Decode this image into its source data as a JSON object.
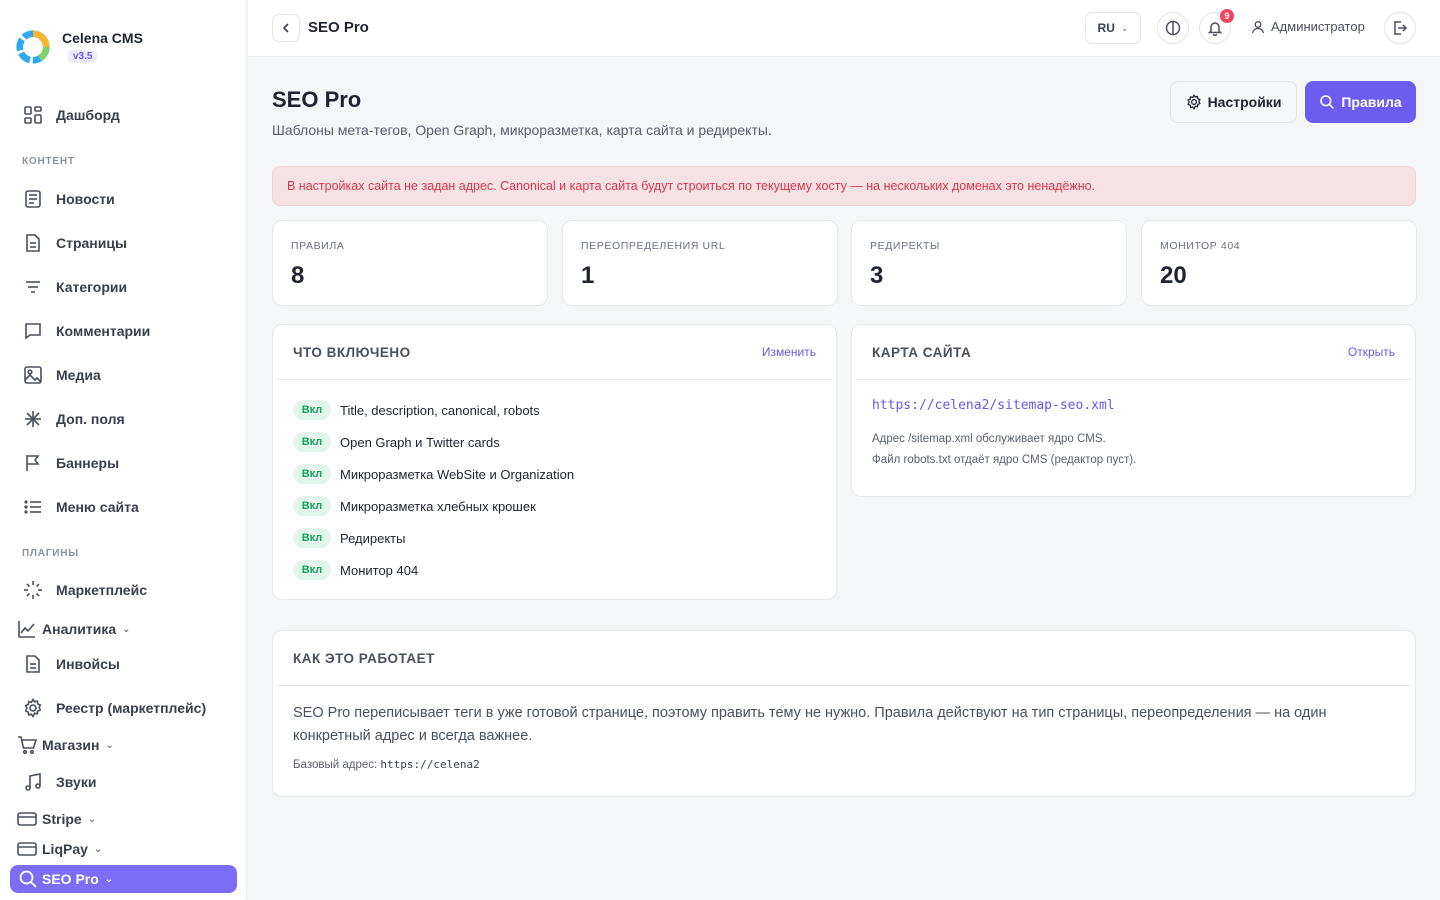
{
  "brand": {
    "name": "Celena CMS",
    "version": "v3.5"
  },
  "sidebar": {
    "items": [
      {
        "label": "Дашборд",
        "icon": "dashboard-icon"
      },
      {
        "label": "Новости",
        "icon": "news-icon"
      },
      {
        "label": "Страницы",
        "icon": "pages-icon"
      },
      {
        "label": "Категории",
        "icon": "categories-icon"
      },
      {
        "label": "Комментарии",
        "icon": "comments-icon"
      },
      {
        "label": "Медиа",
        "icon": "media-icon"
      },
      {
        "label": "Доп. поля",
        "icon": "extra-fields-icon"
      },
      {
        "label": "Баннеры",
        "icon": "flag-icon"
      },
      {
        "label": "Меню сайта",
        "icon": "menu-list-icon"
      },
      {
        "label": "Маркетплейс",
        "icon": "loader-icon"
      },
      {
        "label": "Аналитика",
        "icon": "chart-icon"
      },
      {
        "label": "Инвойсы",
        "icon": "invoice-icon"
      },
      {
        "label": "Реестр (маркетплейс)",
        "icon": "gear-icon"
      },
      {
        "label": "Магазин",
        "icon": "cart-icon"
      },
      {
        "label": "Звуки",
        "icon": "music-icon"
      },
      {
        "label": "Stripe",
        "icon": "card-icon"
      },
      {
        "label": "LiqPay",
        "icon": "card-icon"
      },
      {
        "label": "SEO Pro",
        "icon": "search-icon"
      }
    ],
    "sections": {
      "content": "КОНТЕНТ",
      "plugins": "ПЛАГИНЫ"
    }
  },
  "topbar": {
    "title": "SEO Pro",
    "lang": "RU",
    "notifications": "9",
    "user": "Администратор"
  },
  "page": {
    "title": "SEO Pro",
    "subtitle": "Шаблоны мета-тегов, Open Graph, микроразметка, карта сайта и редиректы.",
    "settings_button": "Настройки",
    "rules_button": "Правила",
    "alert": "В настройках сайта не задан адрес. Canonical и карта сайта будут строиться по текущему хосту — на нескольких доменах это ненадёжно."
  },
  "stats": [
    {
      "label": "ПРАВИЛА",
      "value": "8"
    },
    {
      "label": "ПЕРЕОПРЕДЕЛЕНИЯ URL",
      "value": "1"
    },
    {
      "label": "РЕДИРЕКТЫ",
      "value": "3"
    },
    {
      "label": "МОНИТОР 404",
      "value": "20"
    }
  ],
  "features": {
    "title": "ЧТО ВКЛЮЧЕНО",
    "link": "Изменить",
    "badge": "Вкл",
    "items": [
      "Title, description, canonical, robots",
      "Open Graph и Twitter cards",
      "Микроразметка WebSite и Organization",
      "Микроразметка хлебных крошек",
      "Редиректы",
      "Монитор 404"
    ]
  },
  "sitemap": {
    "title": "КАРТА САЙТА",
    "link": "Открыть",
    "url": "https://celena2/sitemap-seo.xml",
    "note1": "Адрес /sitemap.xml обслуживает ядро CMS.",
    "note2": "Файл robots.txt отдаёт ядро CMS (редактор пуст)."
  },
  "how": {
    "title": "КАК ЭТО РАБОТАЕТ",
    "text": "SEO Pro переписывает теги в уже готовой странице, поэтому править тему не нужно. Правила действуют на тип страницы, переопределения — на один конкретный адрес и всегда важнее.",
    "base_label": "Базовый адрес:",
    "base_url": "https://celena2"
  },
  "colors": {
    "accent": "#6c5cf0",
    "success": "#20a35e",
    "danger": "#d9354a"
  }
}
